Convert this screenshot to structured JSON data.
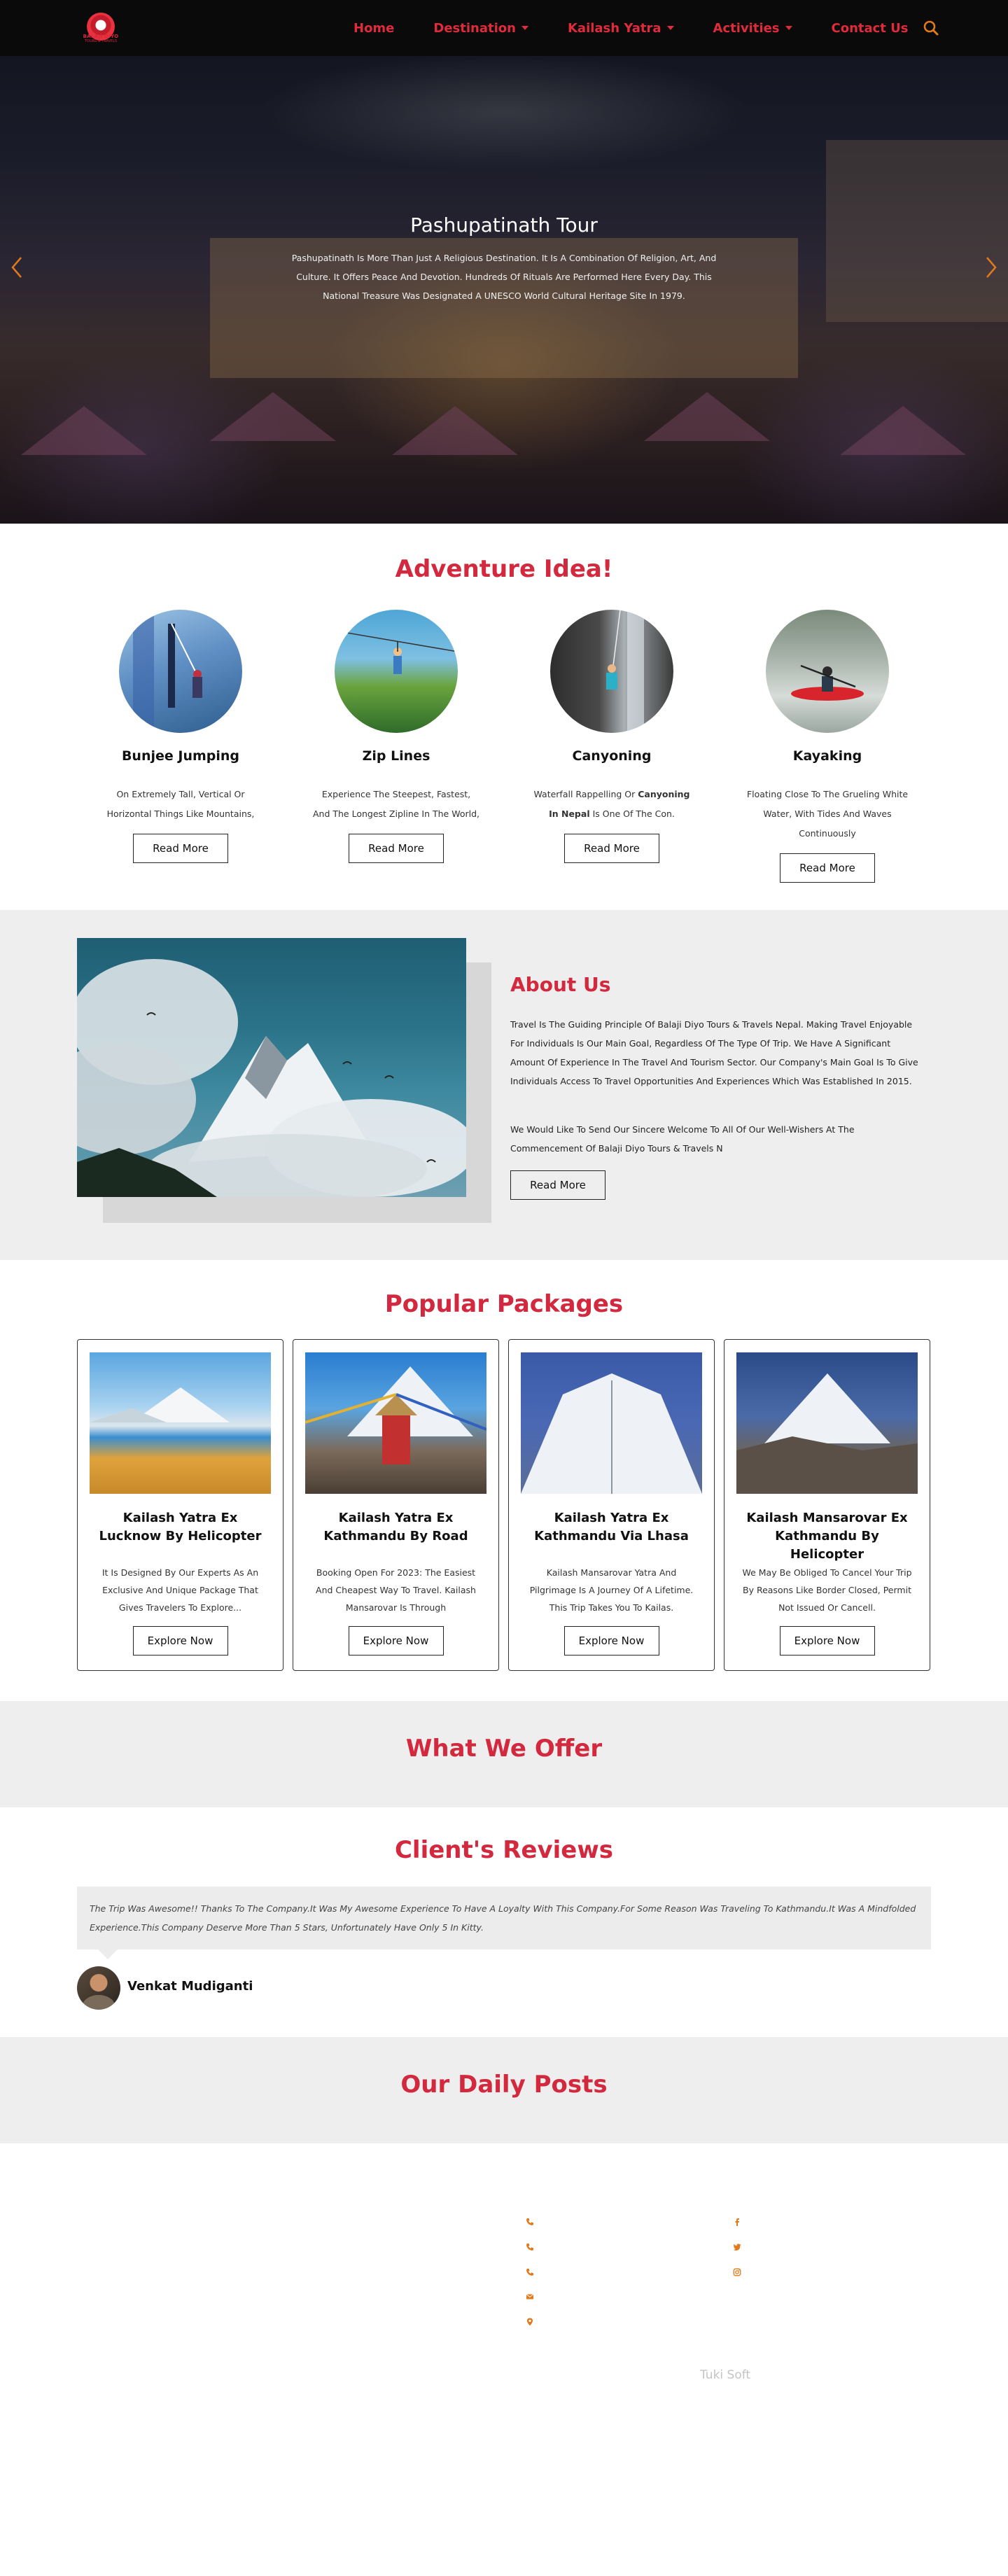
{
  "brand": {
    "name": "BALAJI DIYO",
    "tagline": "TOURS & TRAVELS"
  },
  "nav": {
    "items": [
      {
        "label": "Home",
        "dropdown": false
      },
      {
        "label": "Destination",
        "dropdown": true
      },
      {
        "label": "Kailash Yatra",
        "dropdown": true
      },
      {
        "label": "Activities",
        "dropdown": true
      },
      {
        "label": "Contact Us",
        "dropdown": false
      }
    ],
    "search_icon": "search-icon"
  },
  "hero": {
    "title": "Pashupatinath Tour",
    "description": "Pashupatinath Is More Than Just A Religious Destination. It Is A Combination Of Religion, Art, And Culture. It Offers Peace And Devotion. Hundreds Of Rituals Are Performed Here Every Day. This National Treasure Was Designated A UNESCO World Cultural Heritage Site In 1979."
  },
  "adventure": {
    "title": "Adventure Idea!",
    "button_label": "Read More",
    "items": [
      {
        "name": "Bunjee Jumping",
        "desc": "On Extremely Tall, Vertical Or Horizontal Things Like Mountains, Bridges, And"
      },
      {
        "name": "Zip Lines",
        "desc": "Experience The Steepest, Fastest, And The Longest Zipline In The World, This..."
      },
      {
        "name": "Canyoning",
        "desc_before": "Waterfall Rappelling Or ",
        "desc_bold": "Canyoning In Nepal",
        "desc_after": " Is One Of The Con."
      },
      {
        "name": "Kayaking",
        "desc": "Floating Close To The Grueling White Water, With Tides And Waves Continuously"
      }
    ]
  },
  "about": {
    "title": "About Us",
    "p1": "Travel Is The Guiding Principle Of Balaji Diyo Tours & Travels Nepal. Making Travel Enjoyable For Individuals Is Our Main Goal, Regardless Of The Type Of Trip. We Have A Significant Amount Of Experience In The Travel And Tourism Sector. Our Company's Main Goal Is To Give Individuals Access To Travel Opportunities And Experiences Which Was Established In 2015.",
    "p2": "We Would Like To Send Our Sincere Welcome To All Of Our Well-Wishers At The Commencement Of Balaji Diyo Tours & Travels N",
    "button_label": "Read More"
  },
  "packages": {
    "title": "Popular Packages",
    "button_label": "Explore Now",
    "items": [
      {
        "name": "Kailash Yatra Ex Lucknow By Helicopter",
        "desc": "It Is Designed By Our Experts As An Exclusive And Unique Package That Gives Travelers To Explore..."
      },
      {
        "name": "Kailash Yatra Ex Kathmandu By Road",
        "desc": "Booking Open For 2023: The Easiest And Cheapest Way To Travel. Kailash Mansarovar Is Through"
      },
      {
        "name": "Kailash Yatra Ex Kathmandu Via Lhasa",
        "desc": "Kailash Mansarovar Yatra And Pilgrimage Is A Journey Of A Lifetime. This Trip Takes You To Kailas."
      },
      {
        "name": "Kailash Mansarovar Ex Kathmandu By Helicopter",
        "desc": "We May Be Obliged To Cancel Your Trip By Reasons Like Border Closed, Permit Not Issued Or Cancell."
      }
    ]
  },
  "offer": {
    "title": "What We Offer"
  },
  "reviews": {
    "title": "Client's Reviews",
    "text": "The Trip Was Awesome!! Thanks To The Company.It Was My Awesome Experience To Have A Loyalty With This Company.For Some Reason Was Traveling To Kathmandu.It Was A Mindfolded Experience.This Company Deserve More Than 5 Stars, Unfortunately Have Only 5 In Kitty.",
    "name": "Venkat Mudiganti"
  },
  "posts": {
    "title": "Our Daily Posts"
  },
  "footer": {
    "contact_icons": [
      "phone-icon",
      "phone-icon",
      "phone-icon",
      "envelope-icon",
      "map-pin-icon"
    ],
    "social_icons": [
      "facebook-icon",
      "twitter-icon",
      "instagram-icon"
    ],
    "credit": "Tuki Soft",
    "accent": "#e07a1a"
  },
  "colors": {
    "brand_red": "#d3293e",
    "header_bg": "#0a0a0a",
    "section_gray": "#eeeeee"
  }
}
